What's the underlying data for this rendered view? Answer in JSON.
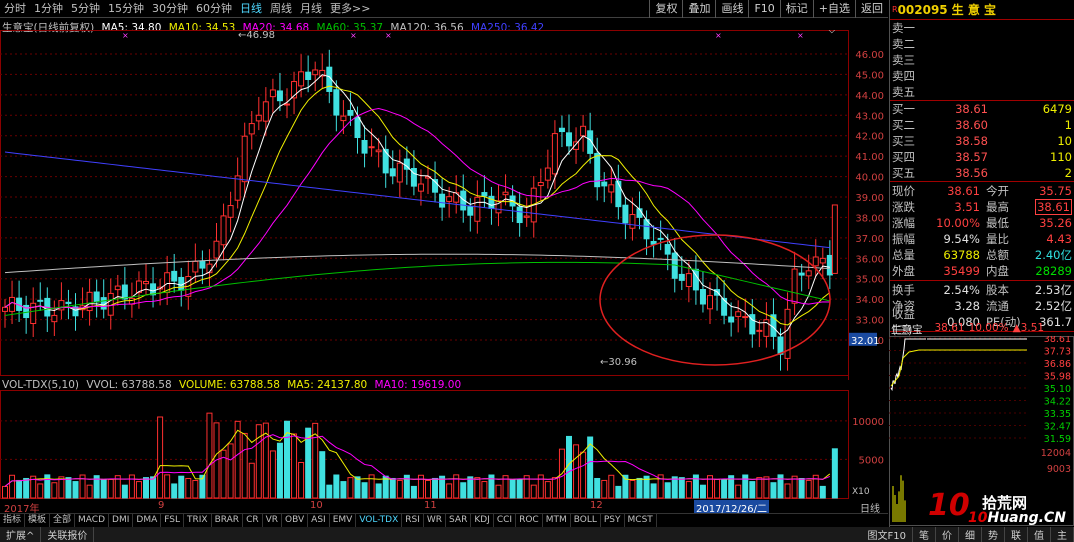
{
  "toolbar": {
    "periods": [
      "分时",
      "1分钟",
      "5分钟",
      "15分钟",
      "30分钟",
      "60分钟",
      "日线",
      "周线",
      "月线",
      "更多>>"
    ],
    "active_period": "日线",
    "tools": [
      "复权",
      "叠加",
      "画线",
      "F10",
      "标记",
      "+自选",
      "返回"
    ]
  },
  "legend": {
    "name": "生意宝(日线前复权)",
    "ma5": "MA5: 34.80",
    "ma10": "MA10: 34.53",
    "ma20": "MA20: 34.68",
    "ma60": "MA60: 35.37",
    "ma120": "MA120: 36.56",
    "ma250": "MA250: 36.42"
  },
  "price_axis": [
    "46.00",
    "45.00",
    "44.00",
    "43.00",
    "42.00",
    "41.00",
    "40.00",
    "39.00",
    "38.00",
    "37.00",
    "36.00",
    "35.00",
    "34.00",
    "33.00",
    "32.00"
  ],
  "price_cursor": "32.01",
  "annotations": {
    "high": "46.98",
    "low": "30.96"
  },
  "vol_legend": {
    "name": "VOL-TDX(5,10)",
    "vvol": "VVOL: 63788.58",
    "volume": "VOLUME: 63788.58",
    "ma5": "MA5: 24137.80",
    "ma10": "MA10: 19619.00"
  },
  "vol_axis": [
    "10000",
    "5000"
  ],
  "vol_unit": "X10",
  "dates": [
    "2017年",
    "9",
    "10",
    "11",
    "12"
  ],
  "date_cursor": "2017/12/26/二",
  "date_right": "日线",
  "indicators": [
    "指标",
    "模板",
    "全部",
    "MACD",
    "DMI",
    "DMA",
    "FSL",
    "TRIX",
    "BRAR",
    "CR",
    "VR",
    "OBV",
    "ASI",
    "EMV",
    "VOL-TDX",
    "RSI",
    "WR",
    "SAR",
    "KDJ",
    "CCI",
    "ROC",
    "MTM",
    "BOLL",
    "PSY",
    "MCST"
  ],
  "active_indicator": "VOL-TDX",
  "bottom_bar": [
    "扩展^",
    "关联报价"
  ],
  "bottom_right": [
    "图文F10",
    "笔",
    "价",
    "细",
    "势",
    "联",
    "值",
    "主"
  ],
  "stock": {
    "code": "002095",
    "name": "生 意 宝",
    "r_mark": "R"
  },
  "sell": [
    {
      "label": "卖五",
      "price": "",
      "vol": ""
    },
    {
      "label": "卖四",
      "price": "",
      "vol": ""
    },
    {
      "label": "卖三",
      "price": "",
      "vol": ""
    },
    {
      "label": "卖二",
      "price": "",
      "vol": ""
    },
    {
      "label": "卖一",
      "price": "",
      "vol": ""
    }
  ],
  "buy": [
    {
      "label": "买一",
      "price": "38.61",
      "vol": "6479"
    },
    {
      "label": "买二",
      "price": "38.60",
      "vol": "1"
    },
    {
      "label": "买三",
      "price": "38.58",
      "vol": "10"
    },
    {
      "label": "买四",
      "price": "38.57",
      "vol": "110"
    },
    {
      "label": "买五",
      "price": "38.56",
      "vol": "2"
    }
  ],
  "quote1": [
    {
      "l": "现价",
      "v": "38.61",
      "vc": "red",
      "l2": "今开",
      "v2": "35.75",
      "v2c": "red"
    },
    {
      "l": "涨跌",
      "v": "3.51",
      "vc": "red",
      "l2": "最高",
      "v2": "38.61",
      "v2c": "red"
    },
    {
      "l": "涨幅",
      "v": "10.00%",
      "vc": "red",
      "l2": "最低",
      "v2": "35.26",
      "v2c": "red"
    },
    {
      "l": "振幅",
      "v": "9.54%",
      "vc": "white",
      "l2": "量比",
      "v2": "4.43",
      "v2c": "red"
    },
    {
      "l": "总量",
      "v": "63788",
      "vc": "yel",
      "l2": "总额",
      "v2": "2.40亿",
      "v2c": "cyan"
    },
    {
      "l": "外盘",
      "v": "35499",
      "vc": "red",
      "l2": "内盘",
      "v2": "28289",
      "v2c": "grn"
    }
  ],
  "quote2": [
    {
      "l": "换手",
      "v": "2.54%",
      "vc": "white",
      "l2": "股本",
      "v2": "2.53亿",
      "v2c": "white"
    },
    {
      "l": "净资",
      "v": "3.28",
      "vc": "white",
      "l2": "流通",
      "v2": "2.52亿",
      "v2c": "white"
    },
    {
      "l": "收益(三)",
      "v": "0.080",
      "vc": "white",
      "l2": "PE(动)",
      "v2": "361.7",
      "v2c": "white"
    }
  ],
  "mini": {
    "name": "生意宝",
    "price": "38.61",
    "pct": "10.00%",
    "chg": "▲3.51",
    "axis": [
      "38.61",
      "37.73",
      "36.86",
      "35.98",
      "35.10",
      "34.22",
      "33.35",
      "32.47",
      "31.59"
    ],
    "vol_axis": [
      "12004",
      "9003"
    ]
  },
  "watermark": {
    "num": "10",
    "title": "拾荒网",
    "url_a": "10",
    "url_b": "Huang.CN"
  },
  "colors": {
    "up": "#ff3030",
    "down": "#40e0e0",
    "ma5": "#ffffff",
    "ma10": "#f0f000",
    "ma20": "#ff00ff",
    "ma60": "#00c000",
    "ma120": "#c0c0c0",
    "ma250": "#4040ff"
  }
}
